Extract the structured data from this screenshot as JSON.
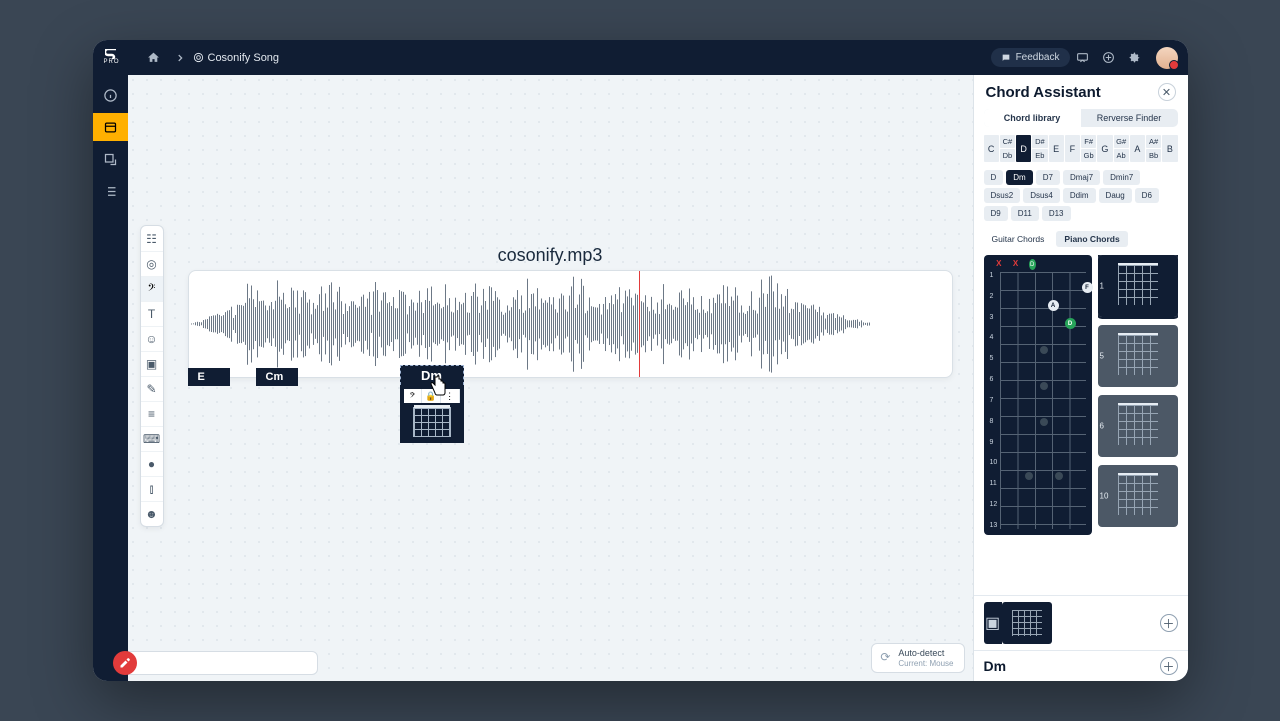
{
  "brand": {
    "pro": "PRO"
  },
  "breadcrumb": {
    "page": "Cosonify Song"
  },
  "topbar": {
    "feedback": "Feedback"
  },
  "canvas": {
    "filename": "cosonify.mp3",
    "chords": {
      "e": "E",
      "cm": "Cm",
      "drag": "Dm"
    },
    "autodetect": {
      "title": "Auto-detect",
      "sub": "Current: Mouse"
    }
  },
  "panel": {
    "title": "Chord Assistant",
    "tabs": {
      "lib": "Chord library",
      "rev": "Rerverse Finder"
    },
    "notes": {
      "row1": [
        "C",
        "C#",
        "D",
        "D#",
        "E",
        "F",
        "F#",
        "G",
        "G#",
        "A",
        "A#",
        "B"
      ],
      "row2": [
        "",
        "Db",
        "",
        "Eb",
        "",
        "",
        "Gb",
        "",
        "Ab",
        "",
        "Bb",
        ""
      ]
    },
    "variants": [
      "D",
      "Dm",
      "D7",
      "Dmaj7",
      "Dmin7",
      "Dsus2",
      "Dsus4",
      "Ddim",
      "Daug",
      "D6",
      "D9",
      "D11",
      "D13"
    ],
    "subtabs": {
      "g": "Guitar Chords",
      "p": "Piano Chords"
    },
    "bigdiag": {
      "frets": [
        "1",
        "2",
        "3",
        "4",
        "5",
        "6",
        "7",
        "8",
        "9",
        "10",
        "11",
        "12",
        "13"
      ],
      "xo": [
        "X",
        "X",
        "D",
        "",
        "",
        ""
      ],
      "labels": {
        "f": "F",
        "a": "A",
        "d": "D"
      }
    },
    "minis": [
      {
        "side": "1"
      },
      {
        "side": "5"
      },
      {
        "side": "6"
      },
      {
        "side": "10"
      }
    ],
    "rows": {
      "r2_label": "Dm"
    }
  }
}
